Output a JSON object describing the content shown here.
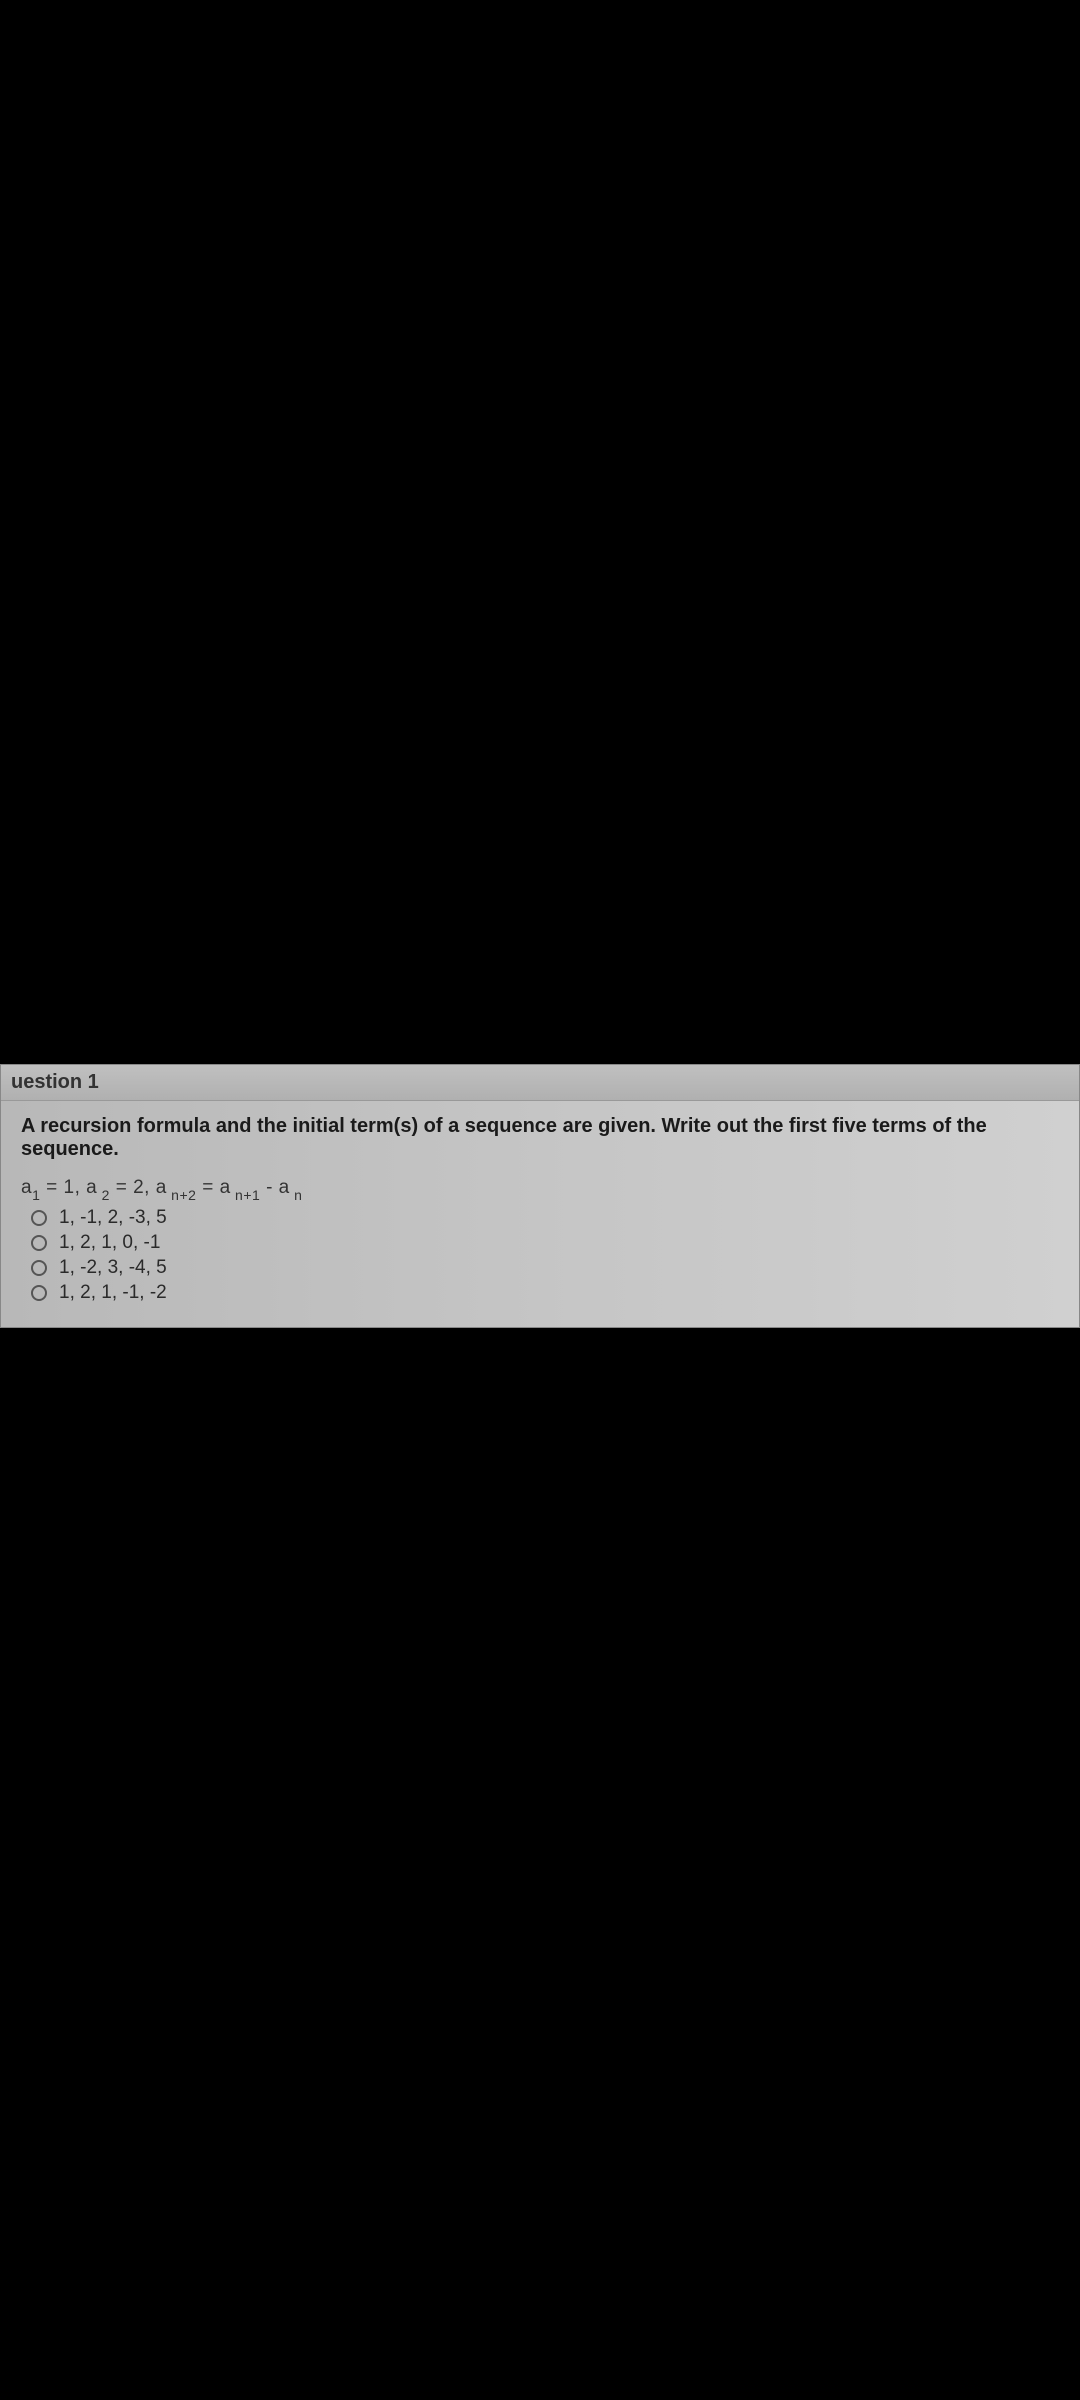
{
  "question": {
    "header": "uestion 1",
    "prompt": "A recursion formula and the initial term(s) of a sequence are given. Write out the first five terms of the sequence.",
    "formula_parts": {
      "a": "a",
      "s1": "1",
      "eq1": " = 1, a",
      "s2": " 2",
      "eq2": " = 2, a",
      "s3": " n+2",
      "eq3": " = a",
      "s4": " n+1",
      "eq4": " - a",
      "s5": " n"
    },
    "options": [
      "1, -1, 2, -3, 5",
      "1, 2, 1, 0, -1",
      "1, -2, 3, -4, 5",
      "1, 2, 1, -1, -2"
    ]
  }
}
